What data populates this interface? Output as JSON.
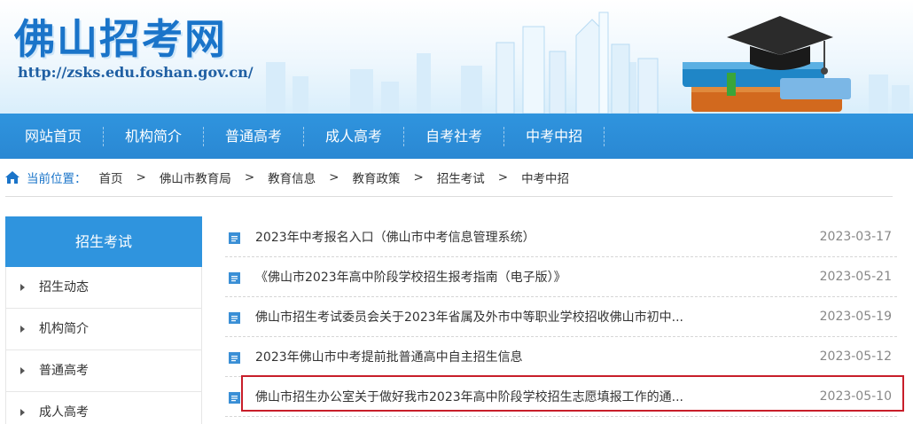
{
  "header": {
    "site_name": "佛山招考网",
    "url": "http://zsks.edu.foshan.gov.cn/"
  },
  "nav": {
    "items": [
      {
        "label": "网站首页"
      },
      {
        "label": "机构简介"
      },
      {
        "label": "普通高考"
      },
      {
        "label": "成人高考"
      },
      {
        "label": "自考社考"
      },
      {
        "label": "中考中招"
      }
    ]
  },
  "breadcrumb": {
    "prefix": "当前位置：",
    "items": [
      "首页",
      "佛山市教育局",
      "教育信息",
      "教育政策",
      "招生考试",
      "中考中招"
    ],
    "separator": ">"
  },
  "sidebar": {
    "title": "招生考试",
    "items": [
      {
        "label": "招生动态"
      },
      {
        "label": "机构简介"
      },
      {
        "label": "普通高考"
      },
      {
        "label": "成人高考"
      }
    ]
  },
  "articles": [
    {
      "title": "2023年中考报名入口（佛山市中考信息管理系统）",
      "date": "2023-03-17"
    },
    {
      "title": "《佛山市2023年高中阶段学校招生报考指南（电子版）》",
      "date": "2023-05-21"
    },
    {
      "title": "佛山市招生考试委员会关于2023年省属及外市中等职业学校招收佛山市初中...",
      "date": "2023-05-19"
    },
    {
      "title": "2023年佛山市中考提前批普通高中自主招生信息",
      "date": "2023-05-12"
    },
    {
      "title": "佛山市招生办公室关于做好我市2023年高中阶段学校招生志愿填报工作的通...",
      "date": "2023-05-10"
    }
  ],
  "colors": {
    "brand_blue": "#2f94de",
    "title_blue": "#1a74c9",
    "highlight_red": "#c81e2a"
  },
  "icons": {
    "breadcrumb": "home-icon",
    "list": "document-icon",
    "sidebar": "triangle-right-icon"
  }
}
